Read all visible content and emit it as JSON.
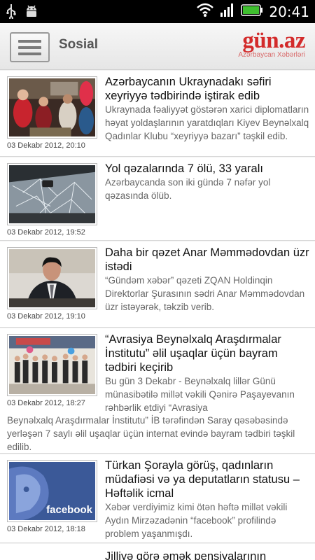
{
  "status": {
    "time": "20:41"
  },
  "header": {
    "title": "Sosial",
    "logo_main": "gün.az",
    "logo_sub": "Azərbaycan Xəbərləri"
  },
  "articles": [
    {
      "title": "Azərbaycanın Ukraynadakı səfiri xeyriyyə tədbirində iştirak edib",
      "summary": "Ukraynada fəaliyyət göstərən xarici diplomatların həyat yoldaşlarının yaratdıqları Kiyev Beynəlxalq Qadınlar Klubu “xeyriyyə bazarı” təşkil edib.",
      "date": "03 Dekabr 2012, 20:10"
    },
    {
      "title": "Yol qəzalarında 7 ölü, 33 yaralı",
      "summary": "Azərbaycanda son iki gündə 7 nəfər yol qəzasında ölüb.",
      "date": "03 Dekabr 2012, 19:52"
    },
    {
      "title": "Daha bir qəzet Anar Məmmədovdan üzr istədi",
      "summary": "“Gündəm xəbər” qəzeti ZQAN Holdinqin Direktorlar Şurasının sədri Anar Məmmədovdan üzr istəyərək, təkzib verib.",
      "date": "03 Dekabr 2012, 19:10"
    },
    {
      "title": "“Avrasiya Beynəlxalq Araşdırmalar İnstitutu” əlil uşaqlar üçün bayram tədbiri keçirib",
      "summary_a": "Bu gün 3 Dekabr - Beynəlxalq  lillər Günü münasibətilə millət vəkili Qənirə Paşayevanın rəhbərlik etdiyi “Avrasiya",
      "summary_b": "Beynəlxalq Araşdırmalar İnstitutu” İB tərəfindən Saray qəsəbəsində yerləşən 7 saylı əlil uşaqlar üçün internat evində bayram tədbiri təşkil edilib.",
      "date": "03 Dekabr 2012, 18:27"
    },
    {
      "title": "Türkan Şorayla görüş, qadınların müdafiəsi və ya deputatların statusu – Həftəlik icmal",
      "summary": "Xəbər verdiyimiz kimi ötən həftə millət vəkili Aydın Mirzəzadənin “facebook” profilində problem yaşanmışdı.",
      "date": "03 Dekabr 2012, 18:18",
      "thumb_text": "facebook"
    },
    {
      "title": "Jilliyə görə əmək pensiyalarının"
    }
  ]
}
